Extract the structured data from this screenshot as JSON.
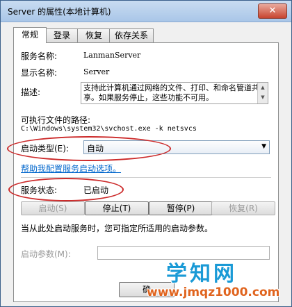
{
  "window": {
    "title": "Server 的属性(本地计算机)",
    "close_glyph": "✕"
  },
  "tabs": [
    "常规",
    "登录",
    "恢复",
    "依存关系"
  ],
  "general": {
    "service_name_label": "服务名称:",
    "service_name_value": "LanmanServer",
    "display_name_label": "显示名称:",
    "display_name_value": "Server",
    "description_label": "描述:",
    "description_value": "支持此计算机通过网络的文件、打印、和命名管道共享。如果服务停止，这些功能不可用。",
    "exe_path_label": "可执行文件的路径:",
    "exe_path_value": "C:\\Windows\\system32\\svchost.exe -k netsvcs",
    "startup_type_label": "启动类型(E):",
    "startup_type_value": "自动",
    "help_link": "帮助我配置服务启动选项。",
    "status_label": "服务状态:",
    "status_value": "已启动",
    "buttons": {
      "start": "启动(S)",
      "stop": "停止(T)",
      "pause": "暂停(P)",
      "resume": "恢复(R)"
    },
    "hint_text": "当从此处启动服务时，您可指定所适用的启动参数。",
    "start_params_label": "启动参数(M):",
    "start_params_value": ""
  },
  "footer": {
    "ok_label": "确"
  },
  "watermark": {
    "title": "学知网",
    "url": "www.jmqz1000.com"
  },
  "colors": {
    "annotation_red": "#cc2a2a",
    "link_blue": "#0066cc",
    "watermark_blue": "#1a9ad6",
    "watermark_orange": "#e0641e"
  }
}
